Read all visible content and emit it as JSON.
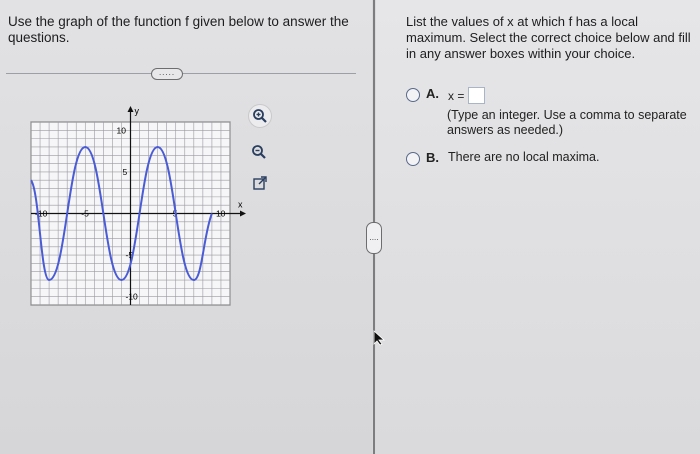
{
  "question": {
    "text": "Use the graph of the function f given below to answer the questions."
  },
  "more_button": {
    "label": "....."
  },
  "graph": {
    "y_axis_label": "y",
    "x_axis_label": "x",
    "ticks": {
      "x_neg10": "-10",
      "x_neg5": "-5",
      "x_5": "5",
      "x_10": "10",
      "y_10": "10",
      "y_5": "5",
      "y_neg5": "-5",
      "y_neg10": "-10"
    },
    "x_range": [
      -11,
      11
    ],
    "y_range": [
      -11,
      11
    ],
    "curve_color": "#4a5bd6",
    "grid_color": "#9a9aa0",
    "extrema_points": [
      {
        "x": -11,
        "y": 4
      },
      {
        "x": -9,
        "y": -8
      },
      {
        "x": -5,
        "y": 8
      },
      {
        "x": -1,
        "y": -8
      },
      {
        "x": 3,
        "y": 8
      },
      {
        "x": 7,
        "y": -8
      },
      {
        "x": 9,
        "y": 0
      }
    ]
  },
  "tools": {
    "zoom_in_icon": "zoom-in-icon",
    "zoom_out_icon": "zoom-out-icon",
    "open_window_icon": "open-window-icon"
  },
  "side_handle": {
    "label": "...."
  },
  "instructions": {
    "text": "List the values of x at which f has a local maximum. Select the correct choice below and fill in any answer boxes within your choice."
  },
  "choice_a": {
    "letter": "A.",
    "equation": "x =",
    "hint": "(Type an integer. Use a comma to separate answers as needed.)"
  },
  "choice_b": {
    "letter": "B.",
    "text": "There are no local maxima."
  }
}
